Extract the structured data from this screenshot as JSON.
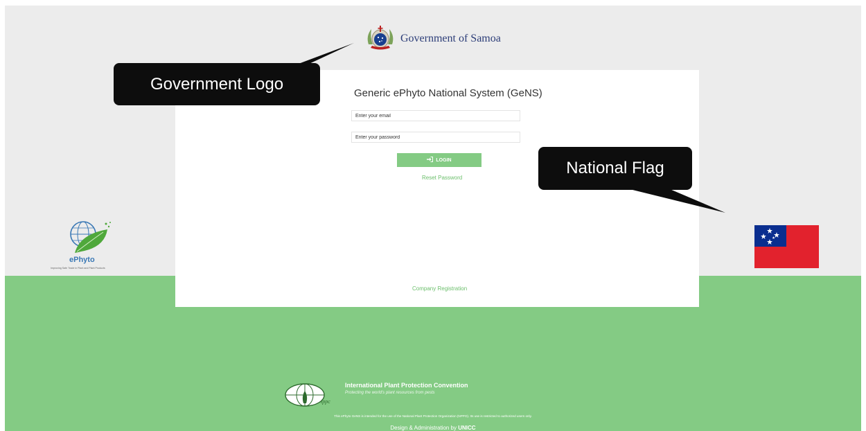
{
  "header": {
    "emblem_icon": "samoa-coat-of-arms-icon",
    "title": "Government of Samoa"
  },
  "login": {
    "system_title": "Generic ePhyto National System (GeNS)",
    "email_placeholder": "Enter your email",
    "password_placeholder": "Enter your password",
    "login_icon": "sign-in-icon",
    "login_label": "LOGIN",
    "reset_password": "Reset Password",
    "company_registration": "Company Registration"
  },
  "ephyto": {
    "logo_icon": "ephyto-globe-leaf-icon",
    "name": "ePhyto",
    "tagline": "Improving Safe Trade in Plant and Plant Products"
  },
  "flag": {
    "icon": "samoa-flag-icon"
  },
  "callouts": {
    "government_logo": "Government Logo",
    "national_flag": "National Flag"
  },
  "footer": {
    "ippc_logo_icon": "ippc-globe-logo-icon",
    "ippc_title": "International Plant Protection Convention",
    "ippc_subtitle": "Protecting the world's plant resources from pests",
    "disclaimer": "This ePhyto GeNS is intended for the use of the National Plant Protection Organization (NPPO). Its use is restricted to authorized users only.",
    "credit_prefix": "Design & Administration by",
    "credit_org": "UNICC"
  },
  "colors": {
    "accent_green": "#84cb84",
    "link_green": "#6cbf6c",
    "header_bg": "#ececec",
    "flag_red": "#e2222d",
    "flag_blue": "#0a2e8f",
    "callout_bg": "#0d0d0d"
  }
}
